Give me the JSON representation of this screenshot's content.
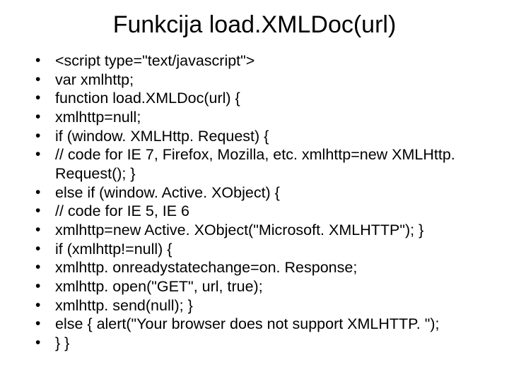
{
  "title": "Funkcija load.XMLDoc(url)",
  "bullets": [
    "<script type=\"text/javascript\">",
    "var xmlhttp;",
    "function load.XMLDoc(url) {",
    "xmlhttp=null;",
    "if (window. XMLHttp. Request) {",
    "// code for IE 7, Firefox, Mozilla, etc. xmlhttp=new XMLHttp. Request(); }",
    "else if (window. Active. XObject) {",
    "// code for IE 5, IE 6",
    "xmlhttp=new Active. XObject(\"Microsoft. XMLHTTP\"); }",
    "if (xmlhttp!=null) {",
    "xmlhttp. onreadystatechange=on. Response;",
    "xmlhttp. open(\"GET\", url, true);",
    "xmlhttp. send(null); }",
    "else { alert(\"Your browser does not support XMLHTTP. \");",
    "} }"
  ]
}
